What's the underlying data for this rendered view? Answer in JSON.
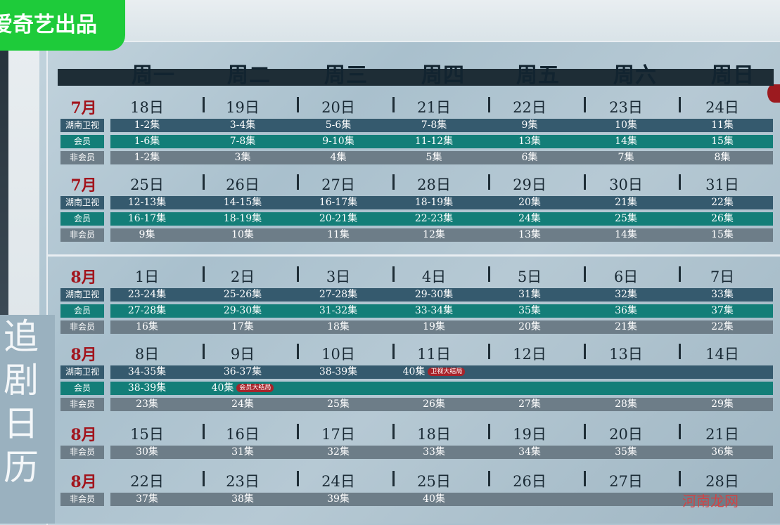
{
  "brand": "爱奇艺出品",
  "vertical_title": [
    "追",
    "剧",
    "日",
    "历"
  ],
  "weekdays": [
    "周一",
    "周二",
    "周三",
    "周四",
    "周五",
    "周六",
    "周日"
  ],
  "row_labels": {
    "hunan": "湖南卫视",
    "vip": "会员",
    "nonvip": "非会员"
  },
  "weeks": [
    {
      "month": "7月",
      "dates": [
        "18日",
        "19日",
        "20日",
        "21日",
        "22日",
        "23日",
        "24日"
      ],
      "hunan": [
        "1-2集",
        "3-4集",
        "5-6集",
        "7-8集",
        "9集",
        "10集",
        "11集"
      ],
      "vip": [
        "1-6集",
        "7-8集",
        "9-10集",
        "11-12集",
        "13集",
        "14集",
        "15集"
      ],
      "nonvip": [
        "1-2集",
        "3集",
        "4集",
        "5集",
        "6集",
        "7集",
        "8集"
      ]
    },
    {
      "month": "7月",
      "dates": [
        "25日",
        "26日",
        "27日",
        "28日",
        "29日",
        "30日",
        "31日"
      ],
      "hunan": [
        "12-13集",
        "14-15集",
        "16-17集",
        "18-19集",
        "20集",
        "21集",
        "22集"
      ],
      "vip": [
        "16-17集",
        "18-19集",
        "20-21集",
        "22-23集",
        "24集",
        "25集",
        "26集"
      ],
      "nonvip": [
        "9集",
        "10集",
        "11集",
        "12集",
        "13集",
        "14集",
        "15集"
      ]
    },
    {
      "month": "8月",
      "dates": [
        "1日",
        "2日",
        "3日",
        "4日",
        "5日",
        "6日",
        "7日"
      ],
      "hunan": [
        "23-24集",
        "25-26集",
        "27-28集",
        "29-30集",
        "31集",
        "32集",
        "33集"
      ],
      "vip": [
        "27-28集",
        "29-30集",
        "31-32集",
        "33-34集",
        "35集",
        "36集",
        "37集"
      ],
      "nonvip": [
        "16集",
        "17集",
        "18集",
        "19集",
        "20集",
        "21集",
        "22集"
      ]
    },
    {
      "month": "8月",
      "dates": [
        "8日",
        "9日",
        "10日",
        "11日",
        "12日",
        "13日",
        "14日"
      ],
      "hunan": [
        "34-35集",
        "36-37集",
        "38-39集",
        "40集",
        "",
        "",
        ""
      ],
      "vip": [
        "38-39集",
        "40集",
        "",
        "",
        "",
        "",
        ""
      ],
      "nonvip": [
        "23集",
        "24集",
        "25集",
        "26集",
        "27集",
        "28集",
        "29集"
      ],
      "hunan_finale_tag": "卫视大结局",
      "vip_finale_tag": "会员大结局"
    },
    {
      "month": "8月",
      "dates": [
        "15日",
        "16日",
        "17日",
        "18日",
        "19日",
        "20日",
        "21日"
      ],
      "nonvip": [
        "30集",
        "31集",
        "32集",
        "33集",
        "34集",
        "35集",
        "36集"
      ]
    },
    {
      "month": "8月",
      "dates": [
        "22日",
        "23日",
        "24日",
        "25日",
        "26日",
        "27日",
        "28日"
      ],
      "nonvip": [
        "37集",
        "38集",
        "39集",
        "40集",
        "",
        "",
        ""
      ]
    }
  ],
  "watermark": "河南龙网",
  "colors": {
    "brand_green": "#1ecb3a",
    "month_red": "#a2141c",
    "hunan_bar": "#355a6e",
    "vip_bar": "#137e78",
    "nonvip_bar": "#6d7d88"
  }
}
